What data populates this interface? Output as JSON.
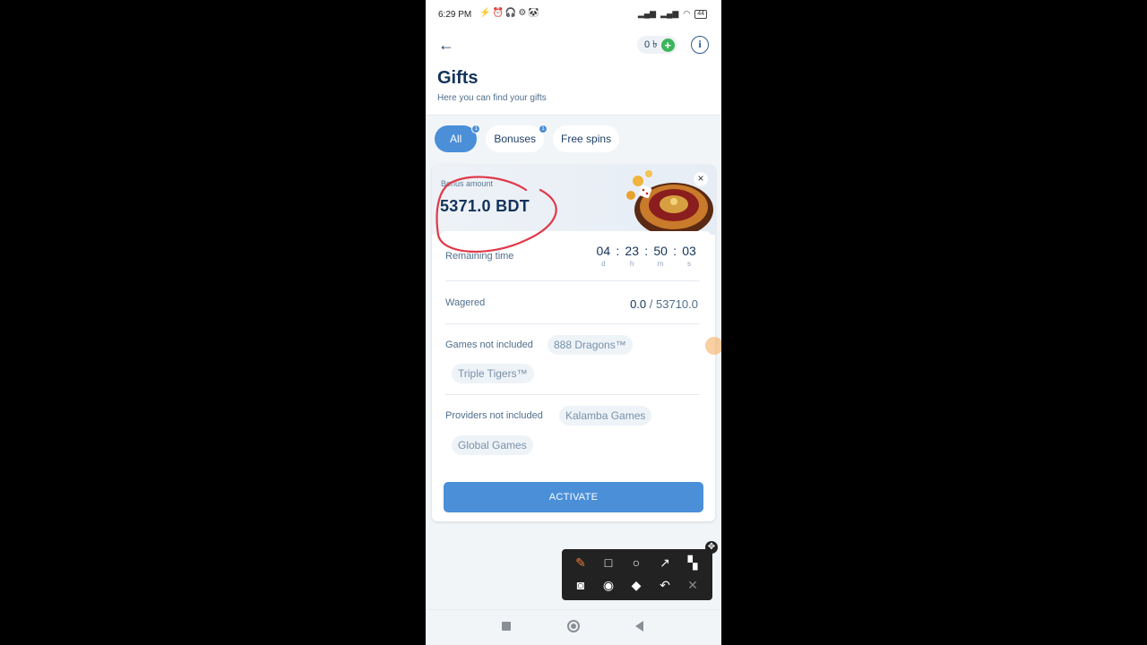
{
  "status_bar": {
    "time": "6:29 PM",
    "battery": "44"
  },
  "header": {
    "balance": "0 ৳",
    "title": "Gifts",
    "subtitle": "Here you can find your gifts"
  },
  "tabs": [
    {
      "label": "All",
      "badge": "1",
      "active": true
    },
    {
      "label": "Bonuses",
      "badge": "1",
      "active": false
    },
    {
      "label": "Free spins",
      "badge": "",
      "active": false
    }
  ],
  "bonus_card": {
    "amount_label": "Bonus amount",
    "amount": "5371.0 BDT",
    "remaining_label": "Remaining time",
    "timer": {
      "days": "04",
      "hours": "23",
      "minutes": "50",
      "seconds": "03",
      "d": "d",
      "h": "h",
      "m": "m",
      "s": "s",
      "sep": ":"
    },
    "wagered_label": "Wagered",
    "wagered_current": "0.0",
    "wagered_total": "/ 53710.0",
    "games_label": "Games not included",
    "games": [
      "888 Dragons™",
      "Triple Tigers™"
    ],
    "providers_label": "Providers not included",
    "providers": [
      "Kalamba Games",
      "Global Games"
    ],
    "activate_label": "ACTIVATE"
  },
  "annotation_colors": {
    "circle": "#e03a4a",
    "accent": "#4a8fd8",
    "plus": "#3cb55a"
  }
}
